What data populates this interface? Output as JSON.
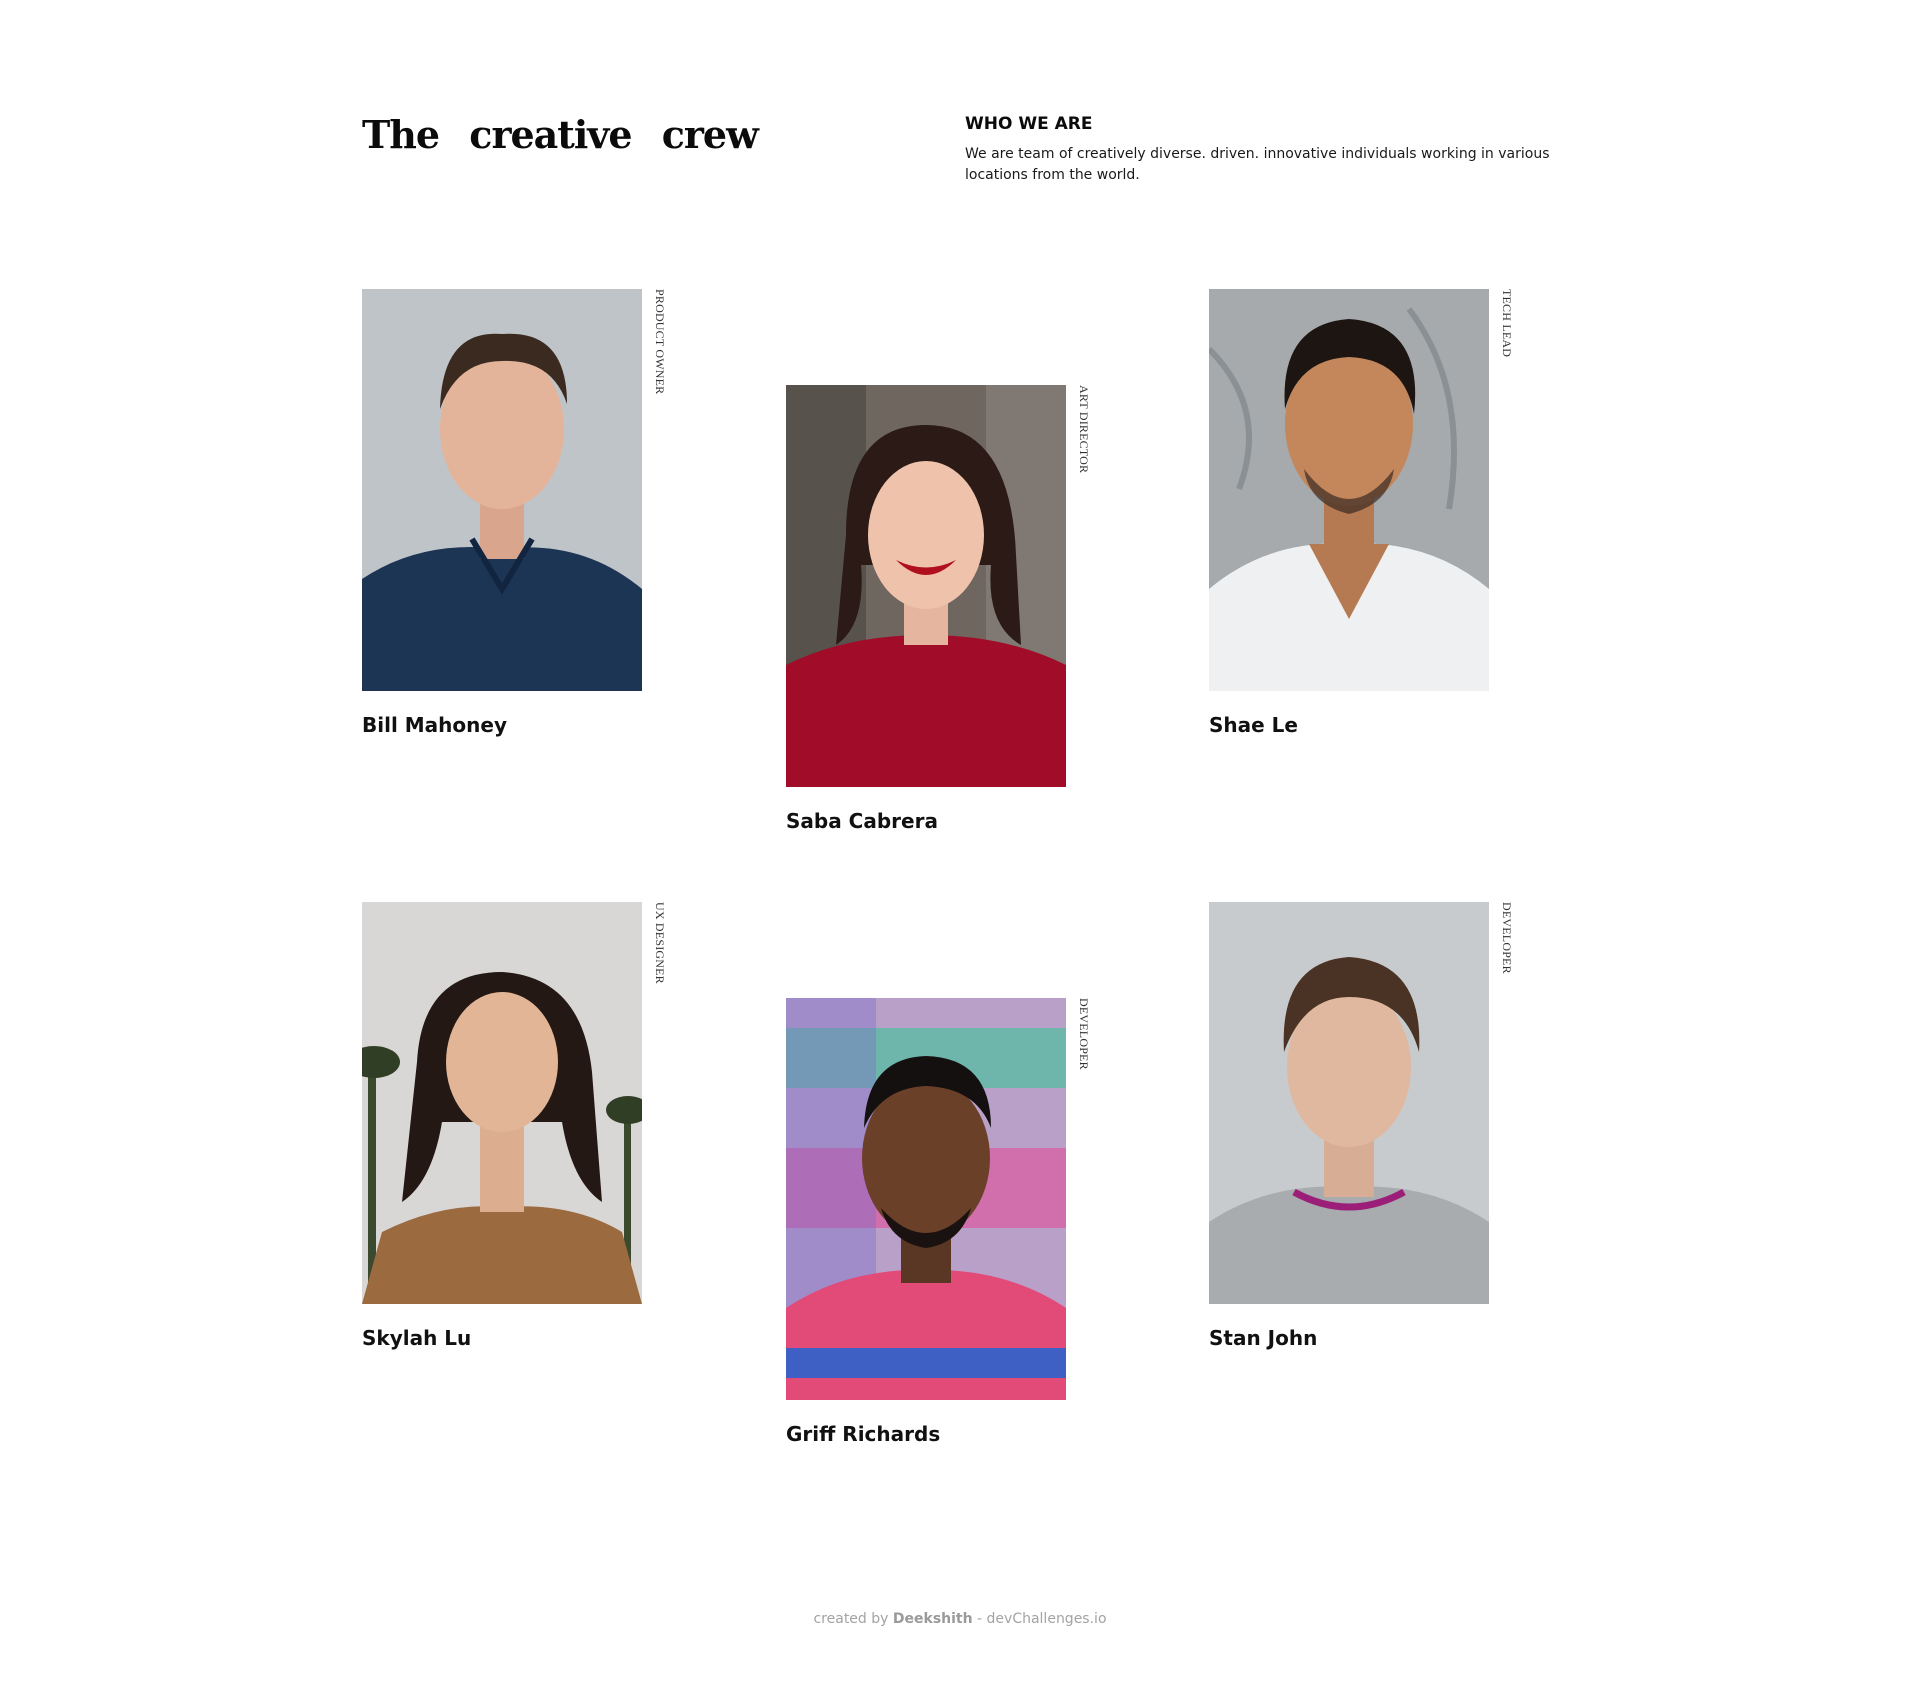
{
  "header": {
    "title": "The creative crew",
    "section_heading": "WHO WE ARE",
    "section_text": "We are team of creatively diverse. driven. innovative individuals working in various locations from the world."
  },
  "members": [
    {
      "name": "Bill Mahoney",
      "role": "PRODUCT OWNER",
      "photo": "portrait-man-navy-polo"
    },
    {
      "name": "Saba Cabrera",
      "role": "ART DIRECTOR",
      "photo": "portrait-woman-red-sweater"
    },
    {
      "name": "Shae Le",
      "role": "TECH LEAD",
      "photo": "portrait-man-white-vneck"
    },
    {
      "name": "Skylah Lu",
      "role": "UX DESIGNER",
      "photo": "portrait-woman-palms"
    },
    {
      "name": "Griff Richards",
      "role": "DEVELOPER",
      "photo": "portrait-man-graffiti"
    },
    {
      "name": "Stan John",
      "role": "DEVELOPER",
      "photo": "portrait-man-grey-sweater"
    }
  ],
  "footer": {
    "prefix": "created by",
    "author": "Deekshith",
    "suffix": "- devChallenges.io"
  },
  "colors": {
    "background": "#ffffff",
    "text": "#111111",
    "footer_text": "#a3a3a3"
  }
}
